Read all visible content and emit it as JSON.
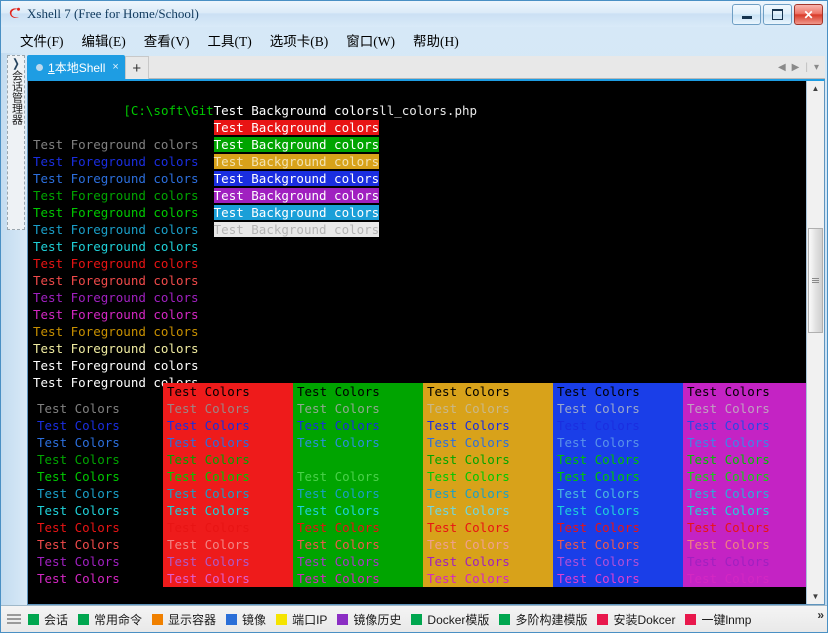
{
  "window": {
    "title": "Xshell 7 (Free for Home/School)",
    "logo_icon": "xshell-logo-icon",
    "minimize_label": "minimize",
    "maximize_label": "maximize",
    "close_label": "close"
  },
  "menubar": {
    "items": [
      {
        "label": "文件(F)"
      },
      {
        "label": "编辑(E)"
      },
      {
        "label": "查看(V)"
      },
      {
        "label": "工具(T)"
      },
      {
        "label": "选项卡(B)"
      },
      {
        "label": "窗口(W)"
      },
      {
        "label": "帮助(H)"
      }
    ]
  },
  "sidebar": {
    "arrow_icon": "chevron-right-icon",
    "vertical_label": "会话管理器"
  },
  "tabs": {
    "items": [
      {
        "num": "1",
        "label": "本地Shell",
        "close": "×"
      }
    ],
    "add_label": "+",
    "nav_prev": "◀",
    "nav_next": "▶",
    "nav_menu": "▾"
  },
  "terminal": {
    "prompt": "[C:\\soft\\Git\\srgb\\srgb\\php]$",
    "command": " php all_colors.php",
    "fg_text": "Test Foreground colors",
    "bg_text": "Test Background colors",
    "cell_text": "Test Colors",
    "palette": {
      "black": "#000000",
      "gray": "#808080",
      "blue": "#1a2ee0",
      "bright_blue": "#2c6fdd",
      "green": "#00a400",
      "bright_green": "#00c800",
      "cyan": "#1a9fc8",
      "bright_cyan": "#1fd0d8",
      "red": "#e81414",
      "bright_red": "#f04a4a",
      "magenta": "#a020c0",
      "bright_magenta": "#d427c3",
      "yellow": "#c89000",
      "bright_yellow": "#f0eca0",
      "white": "#ffffff",
      "bright_white": "#ffffff"
    },
    "foreground_rows": [
      {
        "text": "Test Foreground colors",
        "color": "#000000"
      },
      {
        "text": "Test Foreground colors",
        "color": "#808080"
      },
      {
        "text": "Test Foreground colors",
        "color": "#1a2ee0"
      },
      {
        "text": "Test Foreground colors",
        "color": "#2c6fdd"
      },
      {
        "text": "Test Foreground colors",
        "color": "#00a400"
      },
      {
        "text": "Test Foreground colors",
        "color": "#00c800"
      },
      {
        "text": "Test Foreground colors",
        "color": "#1a9fc8"
      },
      {
        "text": "Test Foreground colors",
        "color": "#1fd0d8"
      },
      {
        "text": "Test Foreground colors",
        "color": "#e81414"
      },
      {
        "text": "Test Foreground colors",
        "color": "#f04a4a"
      },
      {
        "text": "Test Foreground colors",
        "color": "#a020c0"
      },
      {
        "text": "Test Foreground colors",
        "color": "#d427c3"
      },
      {
        "text": "Test Foreground colors",
        "color": "#c89000"
      },
      {
        "text": "Test Foreground colors",
        "color": "#f0eca0"
      },
      {
        "text": "Test Foreground colors",
        "color": "#ffffff"
      },
      {
        "text": "Test Foreground colors",
        "color": "#ffffff"
      }
    ],
    "background_rows": [
      {
        "text": "Test Background colors",
        "bg": "#000000",
        "fg": "#ffffff"
      },
      {
        "text": "Test Background colors",
        "bg": "#e81414",
        "fg": "#ffffff"
      },
      {
        "text": "Test Background colors",
        "bg": "#00a400",
        "fg": "#ffffff"
      },
      {
        "text": "Test Background colors",
        "bg": "#d8a21a",
        "fg": "#f2e3b4"
      },
      {
        "text": "Test Background colors",
        "bg": "#1a2ee0",
        "fg": "#ffffff"
      },
      {
        "text": "Test Background colors",
        "bg": "#a020c0",
        "fg": "#ffffff"
      },
      {
        "text": "Test Background colors",
        "bg": "#1a9fd8",
        "fg": "#ffffff"
      },
      {
        "text": "Test Background colors",
        "bg": "#e8e8e8",
        "fg": "#b5b5b5"
      }
    ],
    "grid_columns": [
      {
        "name": "black-column",
        "bg": "#000000",
        "rows": [
          {
            "text": "Test Colors",
            "fg": "#000000"
          },
          {
            "text": "Test Colors",
            "fg": "#808080"
          },
          {
            "text": "Test Colors",
            "fg": "#1a2ee0"
          },
          {
            "text": "Test Colors",
            "fg": "#2c6fdd"
          },
          {
            "text": "Test Colors",
            "fg": "#00a400"
          },
          {
            "text": "Test Colors",
            "fg": "#00c800"
          },
          {
            "text": "Test Colors",
            "fg": "#1a9fc8"
          },
          {
            "text": "Test Colors",
            "fg": "#1fd0d8"
          },
          {
            "text": "Test Colors",
            "fg": "#e81414"
          },
          {
            "text": "Test Colors",
            "fg": "#f04a4a"
          },
          {
            "text": "Test Colors",
            "fg": "#a020c0"
          },
          {
            "text": "Test Colors",
            "fg": "#d427c3"
          }
        ]
      },
      {
        "name": "red-column",
        "bg": "#ee1b1b",
        "rows": [
          {
            "text": "Test Colors",
            "fg": "#000000"
          },
          {
            "text": "Test Colors",
            "fg": "#9e8484"
          },
          {
            "text": "Test Colors",
            "fg": "#1a2ee0"
          },
          {
            "text": "Test Colors",
            "fg": "#2c6fdd"
          },
          {
            "text": "Test Colors",
            "fg": "#00a400"
          },
          {
            "text": "Test Colors",
            "fg": "#00c800"
          },
          {
            "text": "Test Colors",
            "fg": "#1a9fc8"
          },
          {
            "text": "Test Colors",
            "fg": "#1fd0d8"
          },
          {
            "text": "Test Colors",
            "fg": "#e81414"
          },
          {
            "text": "Test Colors",
            "fg": "#f08585"
          },
          {
            "text": "Test Colors",
            "fg": "#b05ac8"
          },
          {
            "text": "Test Colors",
            "fg": "#e060d0"
          }
        ]
      },
      {
        "name": "green-column",
        "bg": "#00a400",
        "rows": [
          {
            "text": "Test Colors",
            "fg": "#000000"
          },
          {
            "text": "Test Colors",
            "fg": "#8fa98f"
          },
          {
            "text": "Test Colors",
            "fg": "#1a2ee0"
          },
          {
            "text": "Test Colors",
            "fg": "#2c8fdd"
          },
          {
            "text": "Test Colors",
            "fg": "#00a400"
          },
          {
            "text": "Test Colors",
            "fg": "#4ad04a"
          },
          {
            "text": "Test Colors",
            "fg": "#1a9fc8"
          },
          {
            "text": "Test Colors",
            "fg": "#1fd0d8"
          },
          {
            "text": "Test Colors",
            "fg": "#e81414"
          },
          {
            "text": "Test Colors",
            "fg": "#f05a4a"
          },
          {
            "text": "Test Colors",
            "fg": "#a838c8"
          },
          {
            "text": "Test Colors",
            "fg": "#d427c3"
          }
        ]
      },
      {
        "name": "yellow-column",
        "bg": "#d8a21a",
        "rows": [
          {
            "text": "Test Colors",
            "fg": "#000000"
          },
          {
            "text": "Test Colors",
            "fg": "#c9b88a"
          },
          {
            "text": "Test Colors",
            "fg": "#1a2ee0"
          },
          {
            "text": "Test Colors",
            "fg": "#2c6fdd"
          },
          {
            "text": "Test Colors",
            "fg": "#00a400"
          },
          {
            "text": "Test Colors",
            "fg": "#00c800"
          },
          {
            "text": "Test Colors",
            "fg": "#1a9fc8"
          },
          {
            "text": "Test Colors",
            "fg": "#6fd8e0"
          },
          {
            "text": "Test Colors",
            "fg": "#e81414"
          },
          {
            "text": "Test Colors",
            "fg": "#f0a090"
          },
          {
            "text": "Test Colors",
            "fg": "#a020c0"
          },
          {
            "text": "Test Colors",
            "fg": "#d427c3"
          }
        ]
      },
      {
        "name": "blue-column",
        "bg": "#1a3ee8",
        "rows": [
          {
            "text": "Test Colors",
            "fg": "#000000"
          },
          {
            "text": "Test Colors",
            "fg": "#9aa8cc"
          },
          {
            "text": "Test Colors",
            "fg": "#1a2ee0"
          },
          {
            "text": "Test Colors",
            "fg": "#5a92e8"
          },
          {
            "text": "Test Colors",
            "fg": "#00c000"
          },
          {
            "text": "Test Colors",
            "fg": "#00c800"
          },
          {
            "text": "Test Colors",
            "fg": "#4ab8dd"
          },
          {
            "text": "Test Colors",
            "fg": "#1fd0d8"
          },
          {
            "text": "Test Colors",
            "fg": "#e81414"
          },
          {
            "text": "Test Colors",
            "fg": "#f05a4a"
          },
          {
            "text": "Test Colors",
            "fg": "#b050d8"
          },
          {
            "text": "Test Colors",
            "fg": "#e040d0"
          }
        ]
      },
      {
        "name": "magenta-column",
        "bg": "#c423c4",
        "rows": [
          {
            "text": "Test Colors",
            "fg": "#000000"
          },
          {
            "text": "Test Colors",
            "fg": "#c0a0c0"
          },
          {
            "text": "Test Colors",
            "fg": "#2a46e8"
          },
          {
            "text": "Test Colors",
            "fg": "#3c86e8"
          },
          {
            "text": "Test Colors",
            "fg": "#00c000"
          },
          {
            "text": "Test Colors",
            "fg": "#14d014"
          },
          {
            "text": "Test Colors",
            "fg": "#2aaed8"
          },
          {
            "text": "Test Colors",
            "fg": "#1fd0d8"
          },
          {
            "text": "Test Colors",
            "fg": "#e81414"
          },
          {
            "text": "Test Colors",
            "fg": "#f08080"
          },
          {
            "text": "Test Colors",
            "fg": "#a020c0"
          },
          {
            "text": "Test Colors",
            "fg": "#d427c3"
          }
        ]
      }
    ]
  },
  "bottombar": {
    "handle_icon": "drag-handle-icon",
    "overflow_label": "»",
    "items": [
      {
        "label": "会话",
        "color": "#00a64f"
      },
      {
        "label": "常用命令",
        "color": "#00a64f"
      },
      {
        "label": "显示容器",
        "color": "#f08000"
      },
      {
        "label": "镜像",
        "color": "#2a6fd8"
      },
      {
        "label": "端口IP",
        "color": "#f5e400"
      },
      {
        "label": "镜像历史",
        "color": "#8b2ec4"
      },
      {
        "label": "Docker模版",
        "color": "#00a64f"
      },
      {
        "label": "多阶构建模版",
        "color": "#00a64f"
      },
      {
        "label": "安装Dokcer",
        "color": "#e8184c"
      },
      {
        "label": "一键lnmp",
        "color": "#e8184c"
      }
    ]
  }
}
